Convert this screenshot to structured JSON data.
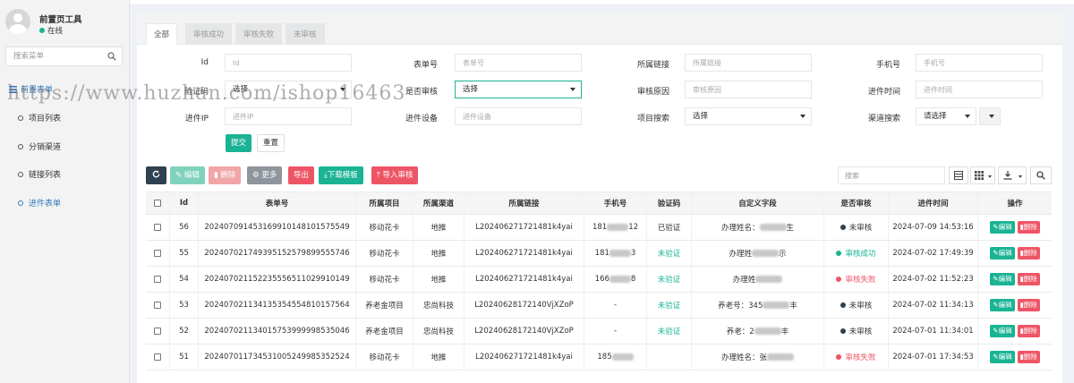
{
  "sidebar": {
    "user_name": "前置页工具",
    "status": "在线",
    "search_placeholder": "搜索菜单",
    "menu_title": "前置表单",
    "items": [
      "项目列表",
      "分销渠道",
      "链接列表",
      "进件表单"
    ]
  },
  "tabs": [
    "全部",
    "审核成功",
    "审核失败",
    "未审核"
  ],
  "filters": {
    "id": {
      "label": "Id",
      "placeholder": "Id"
    },
    "order_no": {
      "label": "表单号",
      "placeholder": "表单号"
    },
    "link": {
      "label": "所属链接",
      "placeholder": "所属链接"
    },
    "phone": {
      "label": "手机号",
      "placeholder": "手机号"
    },
    "captcha": {
      "label": "验证码",
      "value": "选择"
    },
    "audited": {
      "label": "是否审核",
      "value": "选择"
    },
    "reason": {
      "label": "审核原因",
      "placeholder": "审核原因"
    },
    "time": {
      "label": "进件时间",
      "placeholder": "进件时间"
    },
    "ip": {
      "label": "进件IP",
      "placeholder": "进件IP"
    },
    "device": {
      "label": "进件设备",
      "placeholder": "进件设备"
    },
    "project": {
      "label": "项目搜索",
      "value": "选择"
    },
    "channel": {
      "label": "渠道搜索",
      "value": "请选择"
    },
    "submit": "提交",
    "reset": "重置"
  },
  "toolbar": {
    "edit": "编辑",
    "delete": "删除",
    "more": "更多",
    "export": "导出",
    "download_template": "下载模板",
    "import_audit": "导入审核",
    "search_placeholder": "搜索"
  },
  "table": {
    "headers": [
      "Id",
      "表单号",
      "所属项目",
      "所属渠道",
      "所属链接",
      "手机号",
      "验证码",
      "自定义字段",
      "是否审核",
      "进件时间",
      "操作"
    ],
    "rows": [
      {
        "id": "56",
        "order": "20240709145316991014810157554­9",
        "project": "移动花卡",
        "channel": "地推",
        "link": "L202406271721481k4yai",
        "phone_a": "181",
        "phone_b": "12",
        "captcha": "已验证",
        "captcha_green": false,
        "custom": "办理姓名：",
        "custom_tail": "生",
        "status": "未审核",
        "status_color": "#2f4050",
        "status_text_color": "#333",
        "time": "2024-07-09 14:53:16"
      },
      {
        "id": "55",
        "order": "202407021749395152579899555746",
        "project": "移动花卡",
        "channel": "地推",
        "link": "L202406271721481k4yai",
        "phone_a": "181",
        "phone_b": "3",
        "captcha": "未验证",
        "captcha_green": true,
        "custom": "办理姓",
        "custom_tail": "示",
        "status": "审核成功",
        "status_color": "#1ab394",
        "status_text_color": "#1ab394",
        "time": "2024-07-02 17:49:39"
      },
      {
        "id": "54",
        "order": "202407021152235556511029910149",
        "project": "移动花卡",
        "channel": "地推",
        "link": "L202406271721481k4yai",
        "phone_a": "166",
        "phone_b": "8",
        "captcha": "未验证",
        "captcha_green": true,
        "custom": "办理姓",
        "custom_tail": "",
        "status": "审核失败",
        "status_color": "#ed5565",
        "status_text_color": "#ed5565",
        "time": "2024-07-02 11:52:23"
      },
      {
        "id": "53",
        "order": "202407021134135354554810157564",
        "project": "养老金项目",
        "channel": "忠尚科技",
        "link": "L20240628172140VjXZoP",
        "phone_a": "-",
        "phone_b": "",
        "captcha": "未验证",
        "captcha_green": true,
        "custom": "养老号：345",
        "custom_tail": "丰",
        "status": "未审核",
        "status_color": "#2f4050",
        "status_text_color": "#333",
        "time": "2024-07-02 11:34:13"
      },
      {
        "id": "52",
        "order": "202407021134015753999998535046",
        "project": "养老金项目",
        "channel": "忠尚科技",
        "link": "L20240628172140VjXZoP",
        "phone_a": "-",
        "phone_b": "",
        "captcha": "未验证",
        "captcha_green": true,
        "custom": "养老：2",
        "custom_tail": "丰",
        "status": "未审核",
        "status_color": "#2f4050",
        "status_text_color": "#333",
        "time": "2024-07-01 11:34:01"
      },
      {
        "id": "51",
        "order": "202407011734531005249985352524",
        "project": "移动花卡",
        "channel": "地推",
        "link": "L202406271721481k4yai",
        "phone_a": "185",
        "phone_b": "",
        "captcha": "",
        "captcha_green": true,
        "custom": "办理姓名：张",
        "custom_tail": "",
        "status": "审核失败",
        "status_color": "#ed5565",
        "status_text_color": "#ed5565",
        "time": "2024-07-01 17:34:53"
      }
    ],
    "row_edit": "编辑",
    "row_delete": "删除"
  },
  "watermark": "https://www.huzhan.com/ishop16463"
}
